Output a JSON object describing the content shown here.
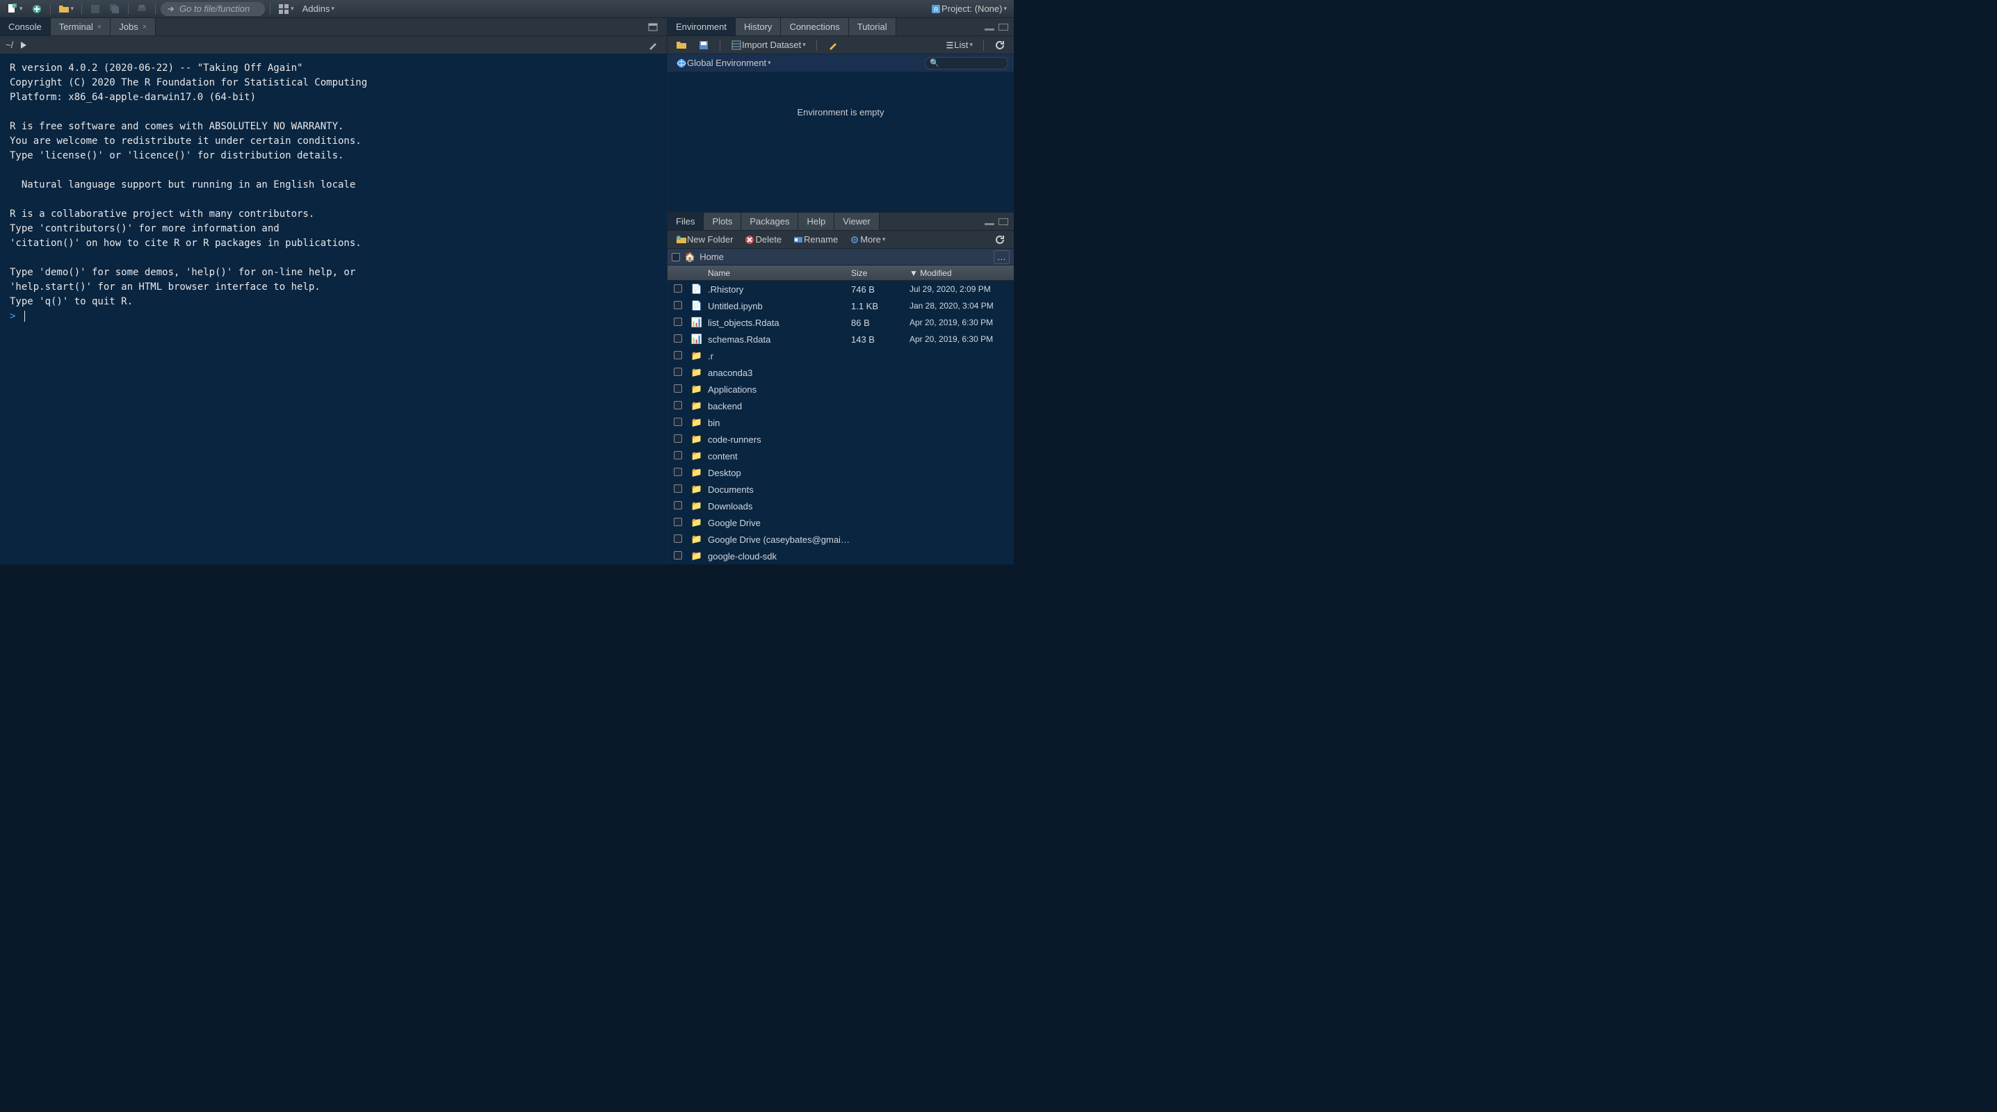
{
  "toolbar": {
    "goto_placeholder": "Go to file/function",
    "addins_label": "Addins",
    "project_label": "Project: (None)"
  },
  "console": {
    "tabs": [
      "Console",
      "Terminal",
      "Jobs"
    ],
    "active_tab": 0,
    "path": "~/",
    "output": "R version 4.0.2 (2020-06-22) -- \"Taking Off Again\"\nCopyright (C) 2020 The R Foundation for Statistical Computing\nPlatform: x86_64-apple-darwin17.0 (64-bit)\n\nR is free software and comes with ABSOLUTELY NO WARRANTY.\nYou are welcome to redistribute it under certain conditions.\nType 'license()' or 'licence()' for distribution details.\n\n  Natural language support but running in an English locale\n\nR is a collaborative project with many contributors.\nType 'contributors()' for more information and\n'citation()' on how to cite R or R packages in publications.\n\nType 'demo()' for some demos, 'help()' for on-line help, or\n'help.start()' for an HTML browser interface to help.\nType 'q()' to quit R.\n",
    "prompt": ">"
  },
  "environment": {
    "tabs": [
      "Environment",
      "History",
      "Connections",
      "Tutorial"
    ],
    "active_tab": 0,
    "import_label": "Import Dataset",
    "list_label": "List",
    "scope_label": "Global Environment",
    "empty_msg": "Environment is empty"
  },
  "files": {
    "tabs": [
      "Files",
      "Plots",
      "Packages",
      "Help",
      "Viewer"
    ],
    "active_tab": 0,
    "toolbar": {
      "new_folder": "New Folder",
      "delete": "Delete",
      "rename": "Rename",
      "more": "More"
    },
    "breadcrumb": "Home",
    "columns": {
      "name": "Name",
      "size": "Size",
      "modified": "Modified"
    },
    "rows": [
      {
        "type": "file",
        "icon": "history",
        "name": ".Rhistory",
        "size": "746 B",
        "modified": "Jul 29, 2020, 2:09 PM"
      },
      {
        "type": "file",
        "icon": "doc",
        "name": "Untitled.ipynb",
        "size": "1.1 KB",
        "modified": "Jan 28, 2020, 3:04 PM"
      },
      {
        "type": "file",
        "icon": "rdata",
        "name": "list_objects.Rdata",
        "size": "86 B",
        "modified": "Apr 20, 2019, 6:30 PM"
      },
      {
        "type": "file",
        "icon": "rdata",
        "name": "schemas.Rdata",
        "size": "143 B",
        "modified": "Apr 20, 2019, 6:30 PM"
      },
      {
        "type": "folder",
        "name": ".r",
        "size": "",
        "modified": ""
      },
      {
        "type": "folder",
        "name": "anaconda3",
        "size": "",
        "modified": ""
      },
      {
        "type": "folder",
        "name": "Applications",
        "size": "",
        "modified": ""
      },
      {
        "type": "folder",
        "name": "backend",
        "size": "",
        "modified": ""
      },
      {
        "type": "folder",
        "name": "bin",
        "size": "",
        "modified": ""
      },
      {
        "type": "folder",
        "name": "code-runners",
        "size": "",
        "modified": ""
      },
      {
        "type": "folder",
        "name": "content",
        "size": "",
        "modified": ""
      },
      {
        "type": "folder",
        "name": "Desktop",
        "size": "",
        "modified": ""
      },
      {
        "type": "folder",
        "name": "Documents",
        "size": "",
        "modified": ""
      },
      {
        "type": "folder",
        "name": "Downloads",
        "size": "",
        "modified": ""
      },
      {
        "type": "folder",
        "name": "Google Drive",
        "size": "",
        "modified": ""
      },
      {
        "type": "folder",
        "name": "Google Drive (caseybates@gmai…",
        "size": "",
        "modified": ""
      },
      {
        "type": "folder",
        "name": "google-cloud-sdk",
        "size": "",
        "modified": ""
      }
    ]
  }
}
